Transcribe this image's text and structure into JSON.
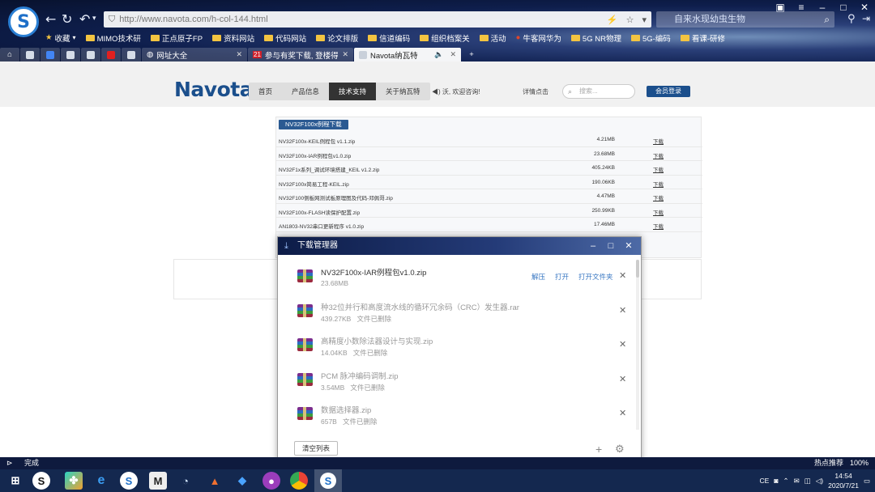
{
  "browser": {
    "url": "http://www.navota.com/h-col-144.html",
    "search_placeholder": "自来水现幼虫生物",
    "bookmarks": [
      {
        "label": "收藏",
        "icon": "star-icon"
      },
      {
        "label": "MIMO技术研",
        "icon": "folder-icon"
      },
      {
        "label": "正点原子FP",
        "icon": "folder-icon"
      },
      {
        "label": "资料网站",
        "icon": "folder-icon"
      },
      {
        "label": "代码网站",
        "icon": "folder-icon"
      },
      {
        "label": "论文排版",
        "icon": "folder-icon"
      },
      {
        "label": "信道编码",
        "icon": "folder-icon"
      },
      {
        "label": "组织档案关",
        "icon": "folder-icon"
      },
      {
        "label": "活动",
        "icon": "folder-icon"
      },
      {
        "label": "牛客网华为",
        "icon": "folder-icon"
      },
      {
        "label": "5G NR物理",
        "icon": "folder-icon"
      },
      {
        "label": "5G-编码",
        "icon": "folder-icon"
      },
      {
        "label": "看课-研修",
        "icon": "folder-icon"
      }
    ],
    "tabs": [
      {
        "label": "网址大全"
      },
      {
        "label": "参与有奖下载, 登楼得!"
      },
      {
        "label": "Navota纳瓦特"
      }
    ],
    "status_text": "完成",
    "status_right": [
      "热点推荐",
      "100%"
    ]
  },
  "site": {
    "brand": "Navota",
    "menu": [
      "首页",
      "产品信息",
      "技术支持",
      "关于纳瓦特"
    ],
    "menu_active_index": 2,
    "welcome": "沃, 欢迎咨询!",
    "detail": "详情点击",
    "search_placeholder": "搜索...",
    "member_button": "会员登录",
    "download_section_title": "NV32F100x例程下载",
    "downloads": [
      {
        "name": "NV32F100x-KEIL例程包 v1.1.zip",
        "size": "4.21MB",
        "link": "下载"
      },
      {
        "name": "NV32F100x-IAR例程包v1.0.zip",
        "size": "23.68MB",
        "link": "下载"
      },
      {
        "name": "NV32F1x系列_调试环境搭建_KEIL v1.2.zip",
        "size": "405.24KB",
        "link": "下载"
      },
      {
        "name": "NV32F100x简易工程-KEIL.zip",
        "size": "190.06KB",
        "link": "下载"
      },
      {
        "name": "NV32F100侧板网测试板原理图及代码-邓佩哥.zip",
        "size": "4.47MB",
        "link": "下载"
      },
      {
        "name": "NV32F100x-FLASH读保护配置.zip",
        "size": "250.99KB",
        "link": "下载"
      },
      {
        "name": "AN1803-NV32串口更新程序 v1.0.zip",
        "size": "17.46MB",
        "link": "下载"
      }
    ]
  },
  "download_manager": {
    "title": "下载管理器",
    "items": [
      {
        "name": "NV32F100x-IAR例程包v1.0.zip",
        "size": "23.68MB",
        "status": "",
        "actions": [
          "解压",
          "打开",
          "打开文件夹"
        ],
        "deleted": false
      },
      {
        "name": "种32位并行和高度流水线的循环冗余码（CRC）发生器.rar",
        "size": "439.27KB",
        "status": "文件已删除",
        "actions": [],
        "deleted": true
      },
      {
        "name": "高精度小数除法器设计与实现.zip",
        "size": "14.04KB",
        "status": "文件已删除",
        "actions": [],
        "deleted": true
      },
      {
        "name": "PCM 脉冲编码调制.zip",
        "size": "3.54MB",
        "status": "文件已删除",
        "actions": [],
        "deleted": true
      },
      {
        "name": "数据选择器.zip",
        "size": "657B",
        "status": "文件已删除",
        "actions": [],
        "deleted": true
      }
    ],
    "clear_button": "清空列表"
  },
  "taskbar": {
    "tray_ime": "CE",
    "time": "14:54",
    "date": "2020/7/21"
  }
}
